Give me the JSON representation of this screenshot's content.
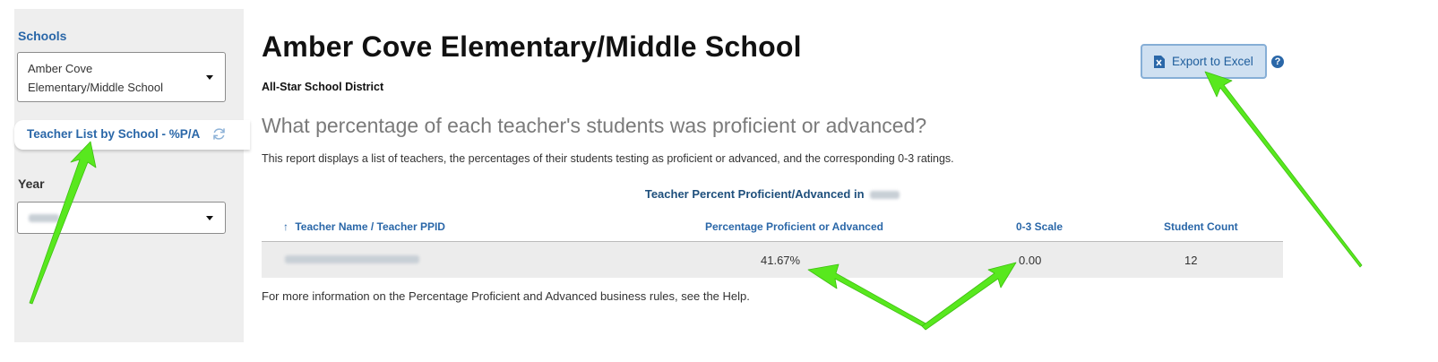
{
  "sidebar": {
    "schools_label": "Schools",
    "school_select_line1": "Amber Cove",
    "school_select_line2": "Elementary/Middle School",
    "nav_item_label": "Teacher List by School - %P/A",
    "year_label": "Year"
  },
  "header": {
    "title": "Amber Cove Elementary/Middle School",
    "district": "All-Star School District",
    "export_label": "Export to Excel",
    "help_glyph": "?"
  },
  "report": {
    "question": "What percentage of each teacher's students was proficient or advanced?",
    "description": "This report displays a list of teachers, the percentages of their students testing as proficient or advanced, and the corresponding 0-3 ratings.",
    "caption": "Teacher Percent Proficient/Advanced in",
    "sort_arrow": "↑",
    "columns": [
      "Teacher Name / Teacher PPID",
      "Percentage Proficient or Advanced",
      "0-3 Scale",
      "Student Count"
    ],
    "rows": [
      {
        "percent": "41.67%",
        "scale": "0.00",
        "count": "12"
      }
    ],
    "footer": "For more information on the Percentage Proficient and Advanced business rules, see the Help."
  },
  "colors": {
    "link_blue": "#2a67a8",
    "annotation_green": "#58e81e"
  }
}
